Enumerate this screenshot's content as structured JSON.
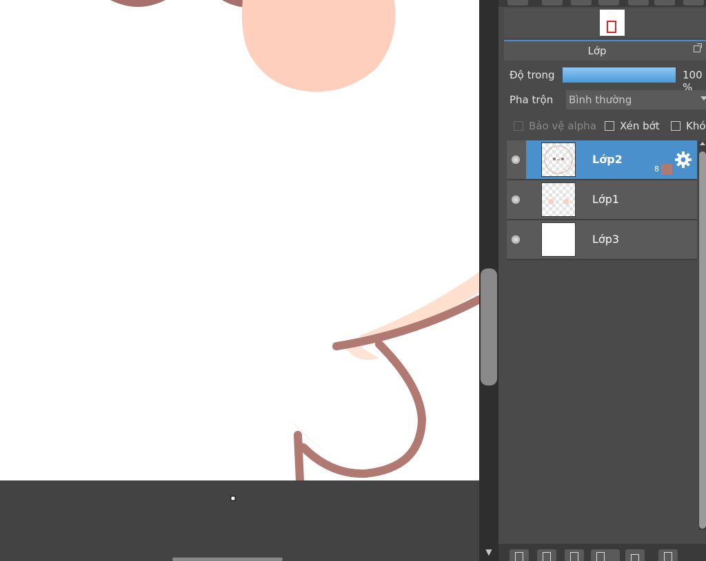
{
  "layers_panel": {
    "title": "Lớp",
    "opacity_label": "Độ trong",
    "opacity_value": "100 %",
    "opacity_fraction": 1.0,
    "blend_label": "Pha trộn",
    "blend_value": "Bình thường",
    "checkboxes": {
      "protect_alpha": "Bảo vệ alpha",
      "clipping": "Xén bớt",
      "lock": "Khóa"
    },
    "layers": [
      {
        "name": "Lớp2",
        "badge": "8",
        "selected": true
      },
      {
        "name": "Lớp1",
        "selected": false
      },
      {
        "name": "Lớp3",
        "selected": false
      }
    ]
  },
  "colors": {
    "accent": "#4a90cc",
    "stroke": "#b07a72",
    "skin": "#ffcfbd"
  },
  "icons": [
    "gear-icon",
    "popout-icon",
    "visibility-icon",
    "new-layer-icon",
    "folder-icon",
    "duplicate-icon"
  ]
}
